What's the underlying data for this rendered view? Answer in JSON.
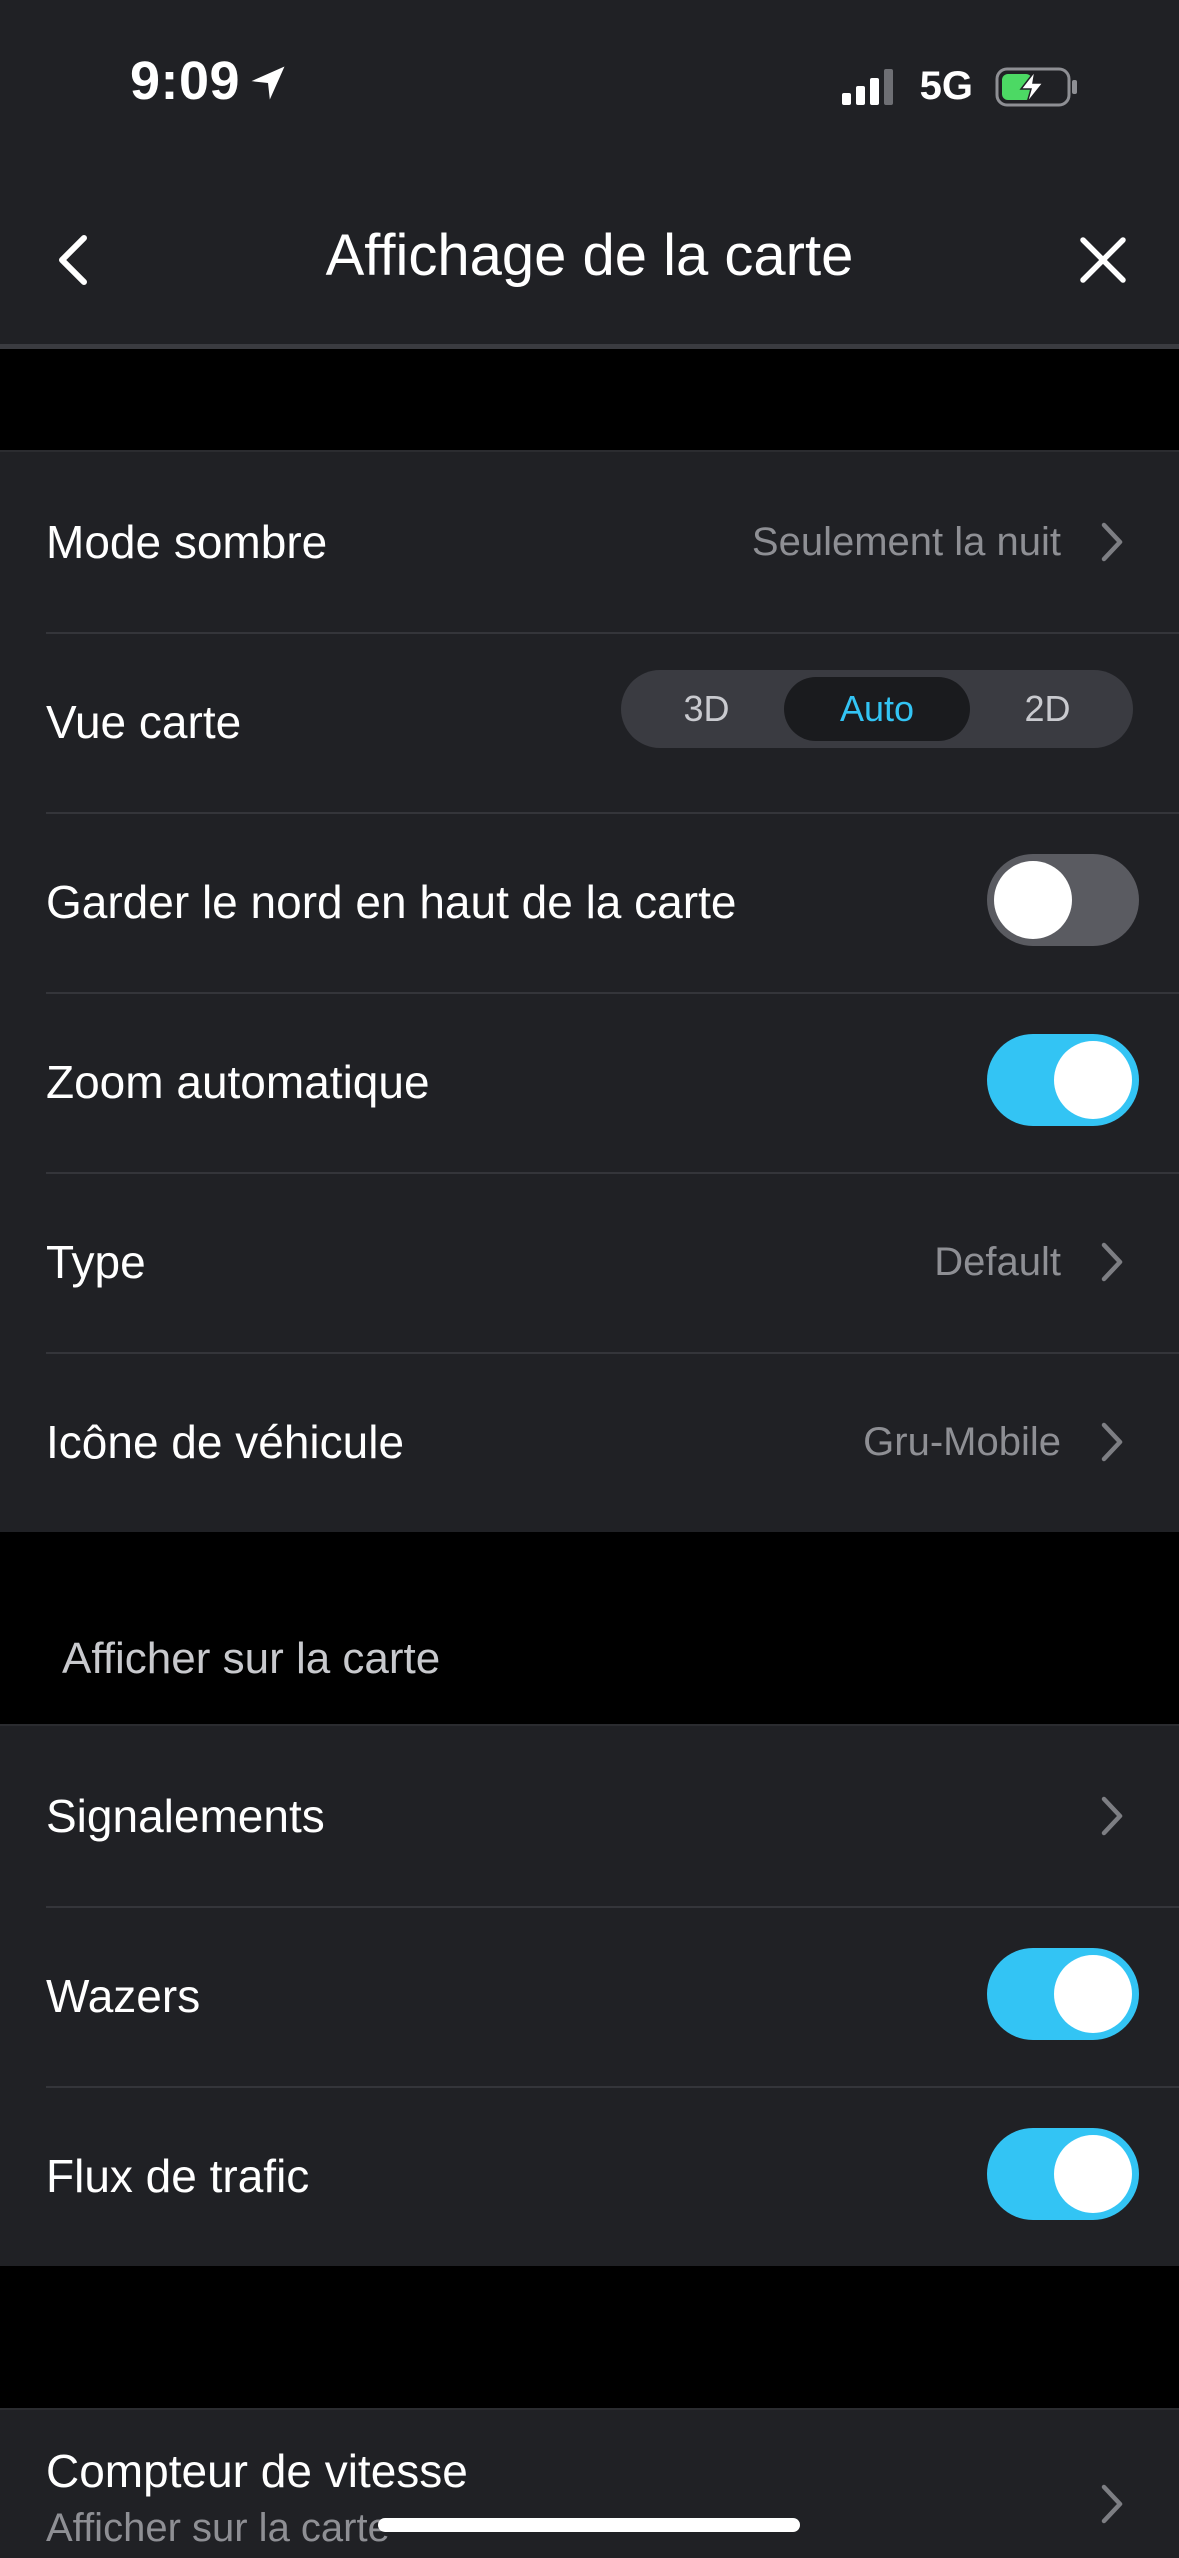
{
  "status_bar": {
    "time": "9:09",
    "network": "5G",
    "icons": [
      "location-arrow-icon",
      "signal-icon",
      "battery-charging-icon"
    ],
    "battery_color": "#4cd964"
  },
  "header": {
    "title": "Affichage de la carte",
    "back_icon": "chevron-left-icon",
    "close_icon": "close-icon"
  },
  "colors": {
    "accent": "#33c4f4",
    "background": "#000000",
    "surface": "#202125",
    "secondary_text": "#8e8f94"
  },
  "group1": {
    "dark_mode": {
      "label": "Mode sombre",
      "value": "Seulement la nuit"
    },
    "map_view": {
      "label": "Vue carte",
      "options": [
        "3D",
        "Auto",
        "2D"
      ],
      "selected": "Auto"
    },
    "north_up": {
      "label": "Garder le nord en haut de la carte",
      "on": false
    },
    "auto_zoom": {
      "label": "Zoom automatique",
      "on": true
    },
    "type": {
      "label": "Type",
      "value": "Default"
    },
    "vehicle_icon": {
      "label": "Icône de véhicule",
      "value": "Gru-Mobile"
    }
  },
  "section_show_on_map": {
    "header": "Afficher sur la carte",
    "reports": {
      "label": "Signalements"
    },
    "wazers": {
      "label": "Wazers",
      "on": true
    },
    "traffic_flow": {
      "label": "Flux de trafic",
      "on": true
    }
  },
  "speedometer": {
    "title": "Compteur de vitesse",
    "subtitle": "Afficher sur la carte"
  }
}
